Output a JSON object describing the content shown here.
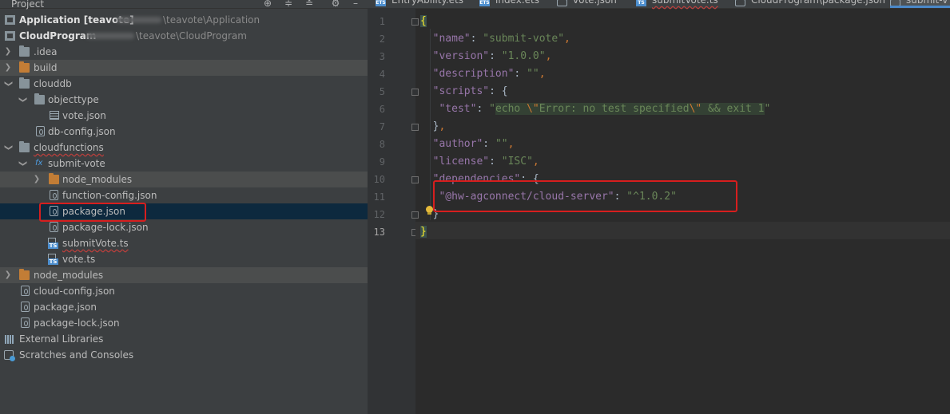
{
  "project_panel": {
    "title": "Project",
    "tree": [
      {
        "label": "Application [teavote]",
        "path": "\\teavote\\Application"
      },
      {
        "label": "CloudProgram",
        "path": "\\teavote\\CloudProgram"
      },
      {
        "label": ".idea"
      },
      {
        "label": "build"
      },
      {
        "label": "clouddb"
      },
      {
        "label": "objecttype"
      },
      {
        "label": "vote.json"
      },
      {
        "label": "db-config.json"
      },
      {
        "label": "cloudfunctions"
      },
      {
        "label": "submit-vote"
      },
      {
        "label": "node_modules"
      },
      {
        "label": "function-config.json"
      },
      {
        "label": "package.json"
      },
      {
        "label": "package-lock.json"
      },
      {
        "label": "submitVote.ts"
      },
      {
        "label": "vote.ts"
      },
      {
        "label": "node_modules"
      },
      {
        "label": "cloud-config.json"
      },
      {
        "label": "package.json"
      },
      {
        "label": "package-lock.json"
      },
      {
        "label": "External Libraries"
      },
      {
        "label": "Scratches and Consoles"
      }
    ],
    "fx_badge": "fx"
  },
  "editor": {
    "tabs": [
      {
        "label": "EntryAbility.ets",
        "icon": "ETS"
      },
      {
        "label": "index.ets",
        "icon": "ETS"
      },
      {
        "label": "vote.json",
        "icon": "json"
      },
      {
        "label": "submitVote.ts",
        "icon": "TS"
      },
      {
        "label": "CloudProgram\\package.json",
        "icon": "json"
      },
      {
        "label": "submit-v",
        "icon": "json"
      }
    ],
    "line_numbers": [
      "1",
      "2",
      "3",
      "4",
      "5",
      "6",
      "7",
      "8",
      "9",
      "10",
      "11",
      "12",
      "13"
    ],
    "code": {
      "l1_brace": "{",
      "l2_key": "\"name\"",
      "l2_val": "\"submit-vote\"",
      "l3_key": "\"version\"",
      "l3_val": "\"1.0.0\"",
      "l4_key": "\"description\"",
      "l4_val": "\"\"",
      "l5_key": "\"scripts\"",
      "l5_brace": "{",
      "l6_key": "\"test\"",
      "l6_val_q": "\"",
      "l6_val_1": "echo ",
      "l6_esc_1": "\\\"",
      "l6_val_2": "Error: no test specified",
      "l6_esc_2": "\\\"",
      "l6_val_3": " && exit 1",
      "l6_val_q2": "\"",
      "l7_close": "}",
      "l8_key": "\"author\"",
      "l8_val": "\"\"",
      "l9_key": "\"license\"",
      "l9_val": "\"ISC\"",
      "l10_key": "\"dependencies\"",
      "l10_brace": "{",
      "l11_key": "\"@hw-agconnect/cloud-server\"",
      "l11_val": "\"^1.0.2\"",
      "l12_close": "}",
      "l13_close": "}",
      "colon": ": ",
      "comma": ","
    }
  },
  "colors": {
    "annotation_red": "#d71e1e",
    "selection_blue": "#0d293e",
    "key_purple": "#9876aa",
    "string_green": "#6a8759",
    "punct_orange": "#cc7832"
  }
}
